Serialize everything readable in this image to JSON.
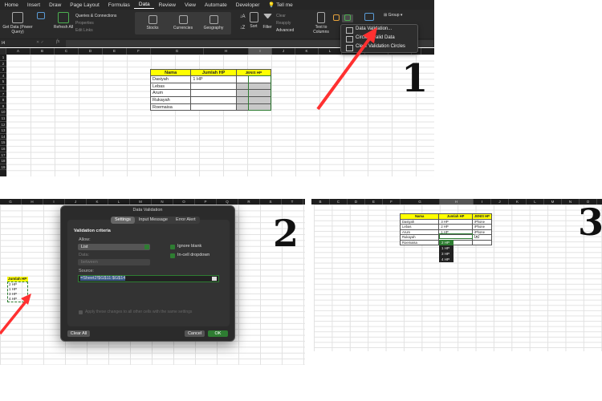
{
  "panel1": {
    "menu_tabs": [
      "Home",
      "Insert",
      "Draw",
      "Page Layout",
      "Formulas",
      "Data",
      "Review",
      "View",
      "Automate",
      "Developer",
      "Tell me"
    ],
    "active_tab": "Data",
    "ribbon": {
      "get_data": "Get Data (Power Query)",
      "refresh_all": "Refresh All",
      "queries_connections": "Queries & Connections",
      "properties": "Properties",
      "edit_links": "Edit Links",
      "stocks": "Stocks",
      "currencies": "Currencies",
      "geography": "Geography",
      "sort": "Sort",
      "filter": "Filter",
      "clear": "Clear",
      "reapply": "Reapply",
      "advanced": "Advanced",
      "text_to_columns": "Text to Columns",
      "group": "Group"
    },
    "name_box": "I4",
    "fx_label": "fx",
    "columns": [
      "A",
      "B",
      "C",
      "D",
      "E",
      "F",
      "G",
      "H",
      "I",
      "J",
      "K",
      "L",
      "M",
      "N",
      "O",
      "P"
    ],
    "rows": [
      "1",
      "2",
      "3",
      "4",
      "5",
      "6",
      "7",
      "8",
      "9",
      "10",
      "11",
      "12",
      "13",
      "14",
      "15",
      "16",
      "17",
      "18",
      "19"
    ],
    "table": {
      "headers": [
        "Nama",
        "Jumlah HP",
        "JENIS HP"
      ],
      "rows": [
        [
          "Dasiyah",
          "1 HP",
          ""
        ],
        [
          "Lebas",
          "",
          ""
        ],
        [
          "Arum",
          "",
          ""
        ],
        [
          "Rukayah",
          "",
          ""
        ],
        [
          "Roemaisa",
          "",
          ""
        ]
      ]
    },
    "dropdown_menu": [
      "Data Validation...",
      "Circle Invalid Data",
      "Clear Validation Circles"
    ],
    "step_number": "1"
  },
  "panel2": {
    "columns": [
      "G",
      "H",
      "I",
      "J",
      "K",
      "L",
      "M",
      "N",
      "O",
      "P",
      "Q",
      "R",
      "S",
      "T"
    ],
    "source_list": {
      "header": "Jumlah HP",
      "items": [
        "2 HP",
        "1 HP",
        "3 HP",
        "4 HP"
      ]
    },
    "dialog": {
      "title": "Data Validation",
      "tabs": [
        "Settings",
        "Input Message",
        "Error Alert"
      ],
      "active_tab": "Settings",
      "section_title": "Validation criteria",
      "allow_label": "Allow:",
      "allow_value": "List",
      "data_label": "Data:",
      "data_value": "between",
      "ignore_blank": "Ignore blank",
      "in_cell_dropdown": "In-cell dropdown",
      "source_label": "Source:",
      "source_value": "=Sheet2!$G$11:$G$14",
      "apply_all": "Apply these changes to all other cells with the same settings",
      "clear_all": "Clear All",
      "cancel": "Cancel",
      "ok": "OK"
    },
    "step_number": "2"
  },
  "panel3": {
    "columns": [
      "B",
      "C",
      "D",
      "E",
      "F",
      "G",
      "H",
      "I",
      "J",
      "K",
      "L",
      "M",
      "N",
      "O"
    ],
    "table": {
      "headers": [
        "Nama",
        "Jumlah HP",
        "JENIS HP"
      ],
      "rows": [
        [
          "Dasiyah",
          "3 HP",
          "iPhone"
        ],
        [
          "Lebas",
          "2 HP",
          "iPhone"
        ],
        [
          "Arum",
          "1 HP",
          "iPhone"
        ],
        [
          "Rukayah",
          "",
          ""
        ],
        [
          "Roemaisa",
          "",
          ""
        ]
      ]
    },
    "dropdown_options": [
      "2 HP",
      "1 HP",
      "3 HP",
      "4 HP"
    ],
    "highlighted_option": "2 HP",
    "step_number": "3"
  },
  "colors": {
    "header_yellow": "#ffff00",
    "excel_green": "#2e7d32",
    "arrow_red": "#ff3030",
    "ribbon_dark": "#2a2a2a"
  }
}
